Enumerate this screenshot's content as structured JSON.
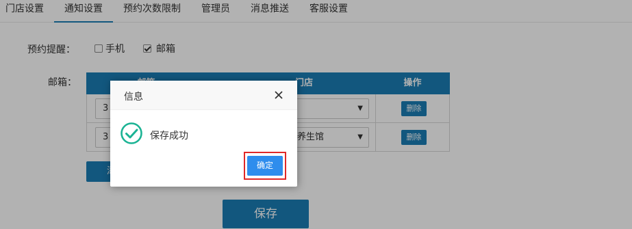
{
  "tabs": [
    {
      "label": "门店设置"
    },
    {
      "label": "通知设置"
    },
    {
      "label": "预约次数限制"
    },
    {
      "label": "管理员"
    },
    {
      "label": "消息推送"
    },
    {
      "label": "客服设置"
    }
  ],
  "reminder": {
    "label": "预约提醒：",
    "phone_label": "手机",
    "phone_checked": false,
    "email_label": "邮箱",
    "email_checked": true
  },
  "email_section": {
    "label": "邮箱：",
    "columns": {
      "email": "邮箱",
      "store": "门店",
      "action": "操作"
    },
    "rows": [
      {
        "email_value": "3",
        "store_value": "",
        "delete_label": "删除"
      },
      {
        "email_value": "3",
        "store_value": "养生馆",
        "delete_label": "删除"
      }
    ],
    "add_label": "添"
  },
  "save_label": "保存",
  "dialog": {
    "title": "信息",
    "message": "保存成功",
    "confirm_label": "确定"
  },
  "colors": {
    "primary": "#1a7db5",
    "confirm": "#2e8ded",
    "highlight": "#e02727",
    "success": "#1bb394"
  }
}
